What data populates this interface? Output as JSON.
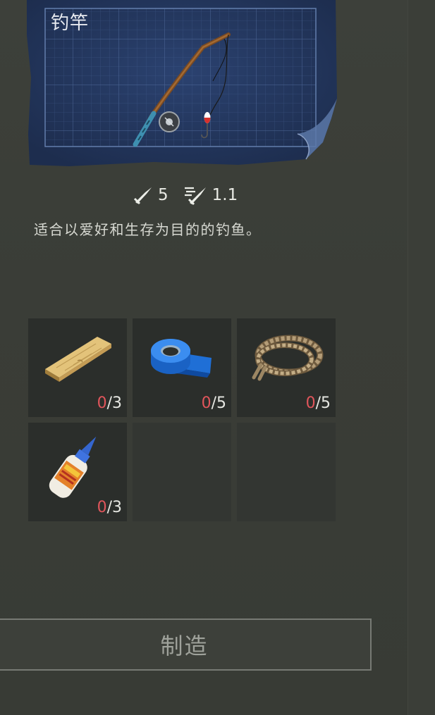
{
  "blueprint": {
    "title": "钓竿",
    "item_icon": "fishing-rod-icon"
  },
  "stats": [
    {
      "icon": "damage-icon",
      "value": "5"
    },
    {
      "icon": "attack-speed-icon",
      "value": "1.1"
    }
  ],
  "description": "适合以爱好和生存为目的的钓鱼。",
  "ingredients": [
    {
      "icon": "plank-icon",
      "have": "0",
      "need": "/3"
    },
    {
      "icon": "duct-tape-icon",
      "have": "0",
      "need": "/5"
    },
    {
      "icon": "rope-icon",
      "have": "0",
      "need": "/5"
    },
    {
      "icon": "glue-icon",
      "have": "0",
      "need": "/3"
    }
  ],
  "craft_button": {
    "label": "制造"
  },
  "colors": {
    "background": "#3a3d37",
    "blueprint": "#23365c",
    "missing_count": "#e0555b",
    "slot": "#2b2e2b"
  }
}
